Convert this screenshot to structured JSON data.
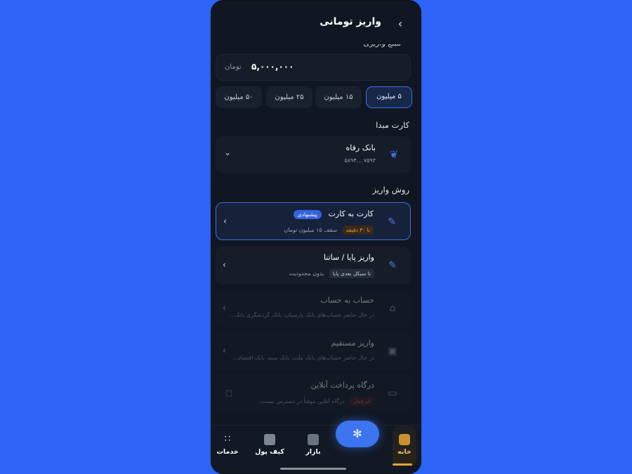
{
  "header": {
    "title": "واریز تومانی",
    "back_icon": "chevron-right-icon",
    "subtitle_partial": "مبلغ واریزی"
  },
  "amount": {
    "value": "۵,۰۰۰,۰۰۰",
    "unit": "تومان"
  },
  "presets": [
    {
      "label": "۵ میلیون",
      "active": true
    },
    {
      "label": "۱۵ میلیون",
      "active": false
    },
    {
      "label": "۲۵ میلیون",
      "active": false
    },
    {
      "label": "۵۰ میلیون",
      "active": false
    }
  ],
  "source_card": {
    "section_label": "کارت مبدا",
    "bank_name": "بانک رفاه",
    "card_number": "۵۸۹۴... ۷۵۹۳"
  },
  "methods_section_label": "روش واریز",
  "methods": [
    {
      "title": "کارت به کارت",
      "badge": "پیشنهادی",
      "tag": "تا ۳۰ دقیقه",
      "sub": "سقف ۱۵ میلیون تومان",
      "selected": true,
      "disabled": false
    },
    {
      "title": "واریز پایا / ساتنا",
      "tag": "تا سیکل بعدی پایا",
      "sub": "بدون محدودیت",
      "selected": false,
      "disabled": false
    },
    {
      "title": "حساب به حساب",
      "sub": "در حال حاضر حساب‌های بانک پارسیان، بانک گردشگری بانک...",
      "selected": false,
      "disabled": true
    },
    {
      "title": "واریز مستقیم",
      "sub": "در حال حاضر حساب‌های بانک ملت، بانک سپه، بانک اقتصاد...",
      "selected": false,
      "disabled": true
    },
    {
      "title": "درگاه پرداخت آنلاین",
      "tag": "غیرفعال",
      "sub": "درگاه آنلاین موقتاً در دسترس نیست.",
      "selected": false,
      "disabled": true
    }
  ],
  "nav": {
    "home": "خانه",
    "market": "بازار",
    "wallet": "کیف پول",
    "services": "خدمات"
  },
  "colors": {
    "accent": "#3f6ee8",
    "home_accent": "#e2a33a",
    "background": "#2d64f5",
    "card": "#161d29"
  }
}
